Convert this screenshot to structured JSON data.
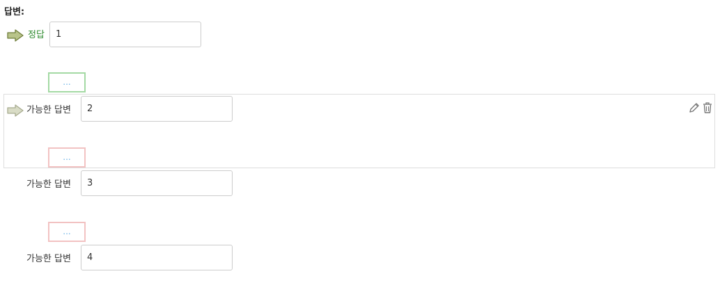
{
  "section_label": "답변:",
  "answers": [
    {
      "label": "정답",
      "value": "1",
      "correct": true
    },
    {
      "label": "가능한 답변",
      "value": "2",
      "correct": false
    },
    {
      "label": "가능한 답변",
      "value": "3",
      "correct": false
    },
    {
      "label": "가능한 답변",
      "value": "4",
      "correct": false
    }
  ],
  "feedback_label": "...",
  "colors": {
    "correct_label": "#2e8b2e",
    "feedback_text": "#6bb2e6",
    "feedback_correct_border": "#a3d9a3",
    "feedback_wrong_border": "#f2c2c2",
    "arrow_fill": "#b9c48a"
  },
  "icons": [
    "arrow-right-icon",
    "pencil-icon",
    "trash-icon"
  ]
}
